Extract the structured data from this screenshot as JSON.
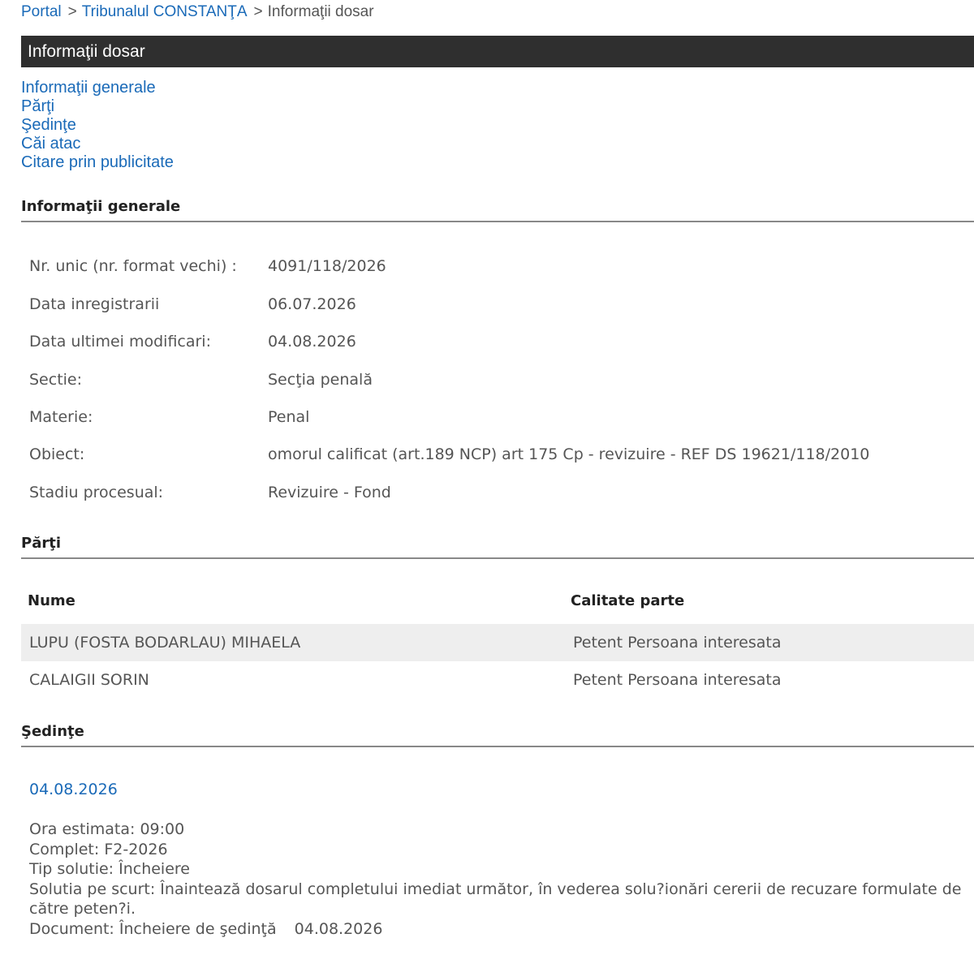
{
  "breadcrumb": {
    "portal": "Portal",
    "sep1": ">",
    "court": "Tribunalul CONSTANŢA",
    "sep2": ">",
    "current": "Informaţii dosar"
  },
  "title": "Informaţii dosar",
  "nav": {
    "items": [
      "Informaţii generale",
      "Părţi",
      "Şedinţe",
      "Căi atac",
      "Citare prin publicitate"
    ]
  },
  "general": {
    "heading": "Informaţii generale",
    "rows": [
      {
        "label": "Nr. unic (nr. format vechi) :",
        "value": "4091/118/2026"
      },
      {
        "label": "Data inregistrarii",
        "value": "06.07.2026"
      },
      {
        "label": "Data ultimei modificari:",
        "value": "04.08.2026"
      },
      {
        "label": "Sectie:",
        "value": "Secţia penală"
      },
      {
        "label": "Materie:",
        "value": "Penal"
      },
      {
        "label": "Obiect:",
        "value": "omorul calificat (art.189 NCP) art 175 Cp - revizuire - REF DS 19621/118/2010"
      },
      {
        "label": "Stadiu procesual:",
        "value": "Revizuire - Fond"
      }
    ]
  },
  "parti": {
    "heading": "Părţi",
    "col_name": "Nume",
    "col_role": "Calitate parte",
    "rows": [
      {
        "name": "LUPU (FOSTA BODARLAU) MIHAELA",
        "role": "Petent Persoana interesata"
      },
      {
        "name": "CALAIGII SORIN",
        "role": "Petent Persoana interesata"
      }
    ]
  },
  "sedinte": {
    "heading": "Şedinţe",
    "date": "04.08.2026",
    "ora": "Ora estimata: 09:00",
    "complet": "Complet: F2-2026",
    "tip": "Tip solutie: Încheiere",
    "solutia": "Solutia pe scurt: Înaintează dosarul completului imediat următor, în vederea solu?ionări cererii de recuzare formulate de către peten?i.",
    "document_label": "Document: Încheiere de şedinţă",
    "document_date": "04.08.2026"
  }
}
